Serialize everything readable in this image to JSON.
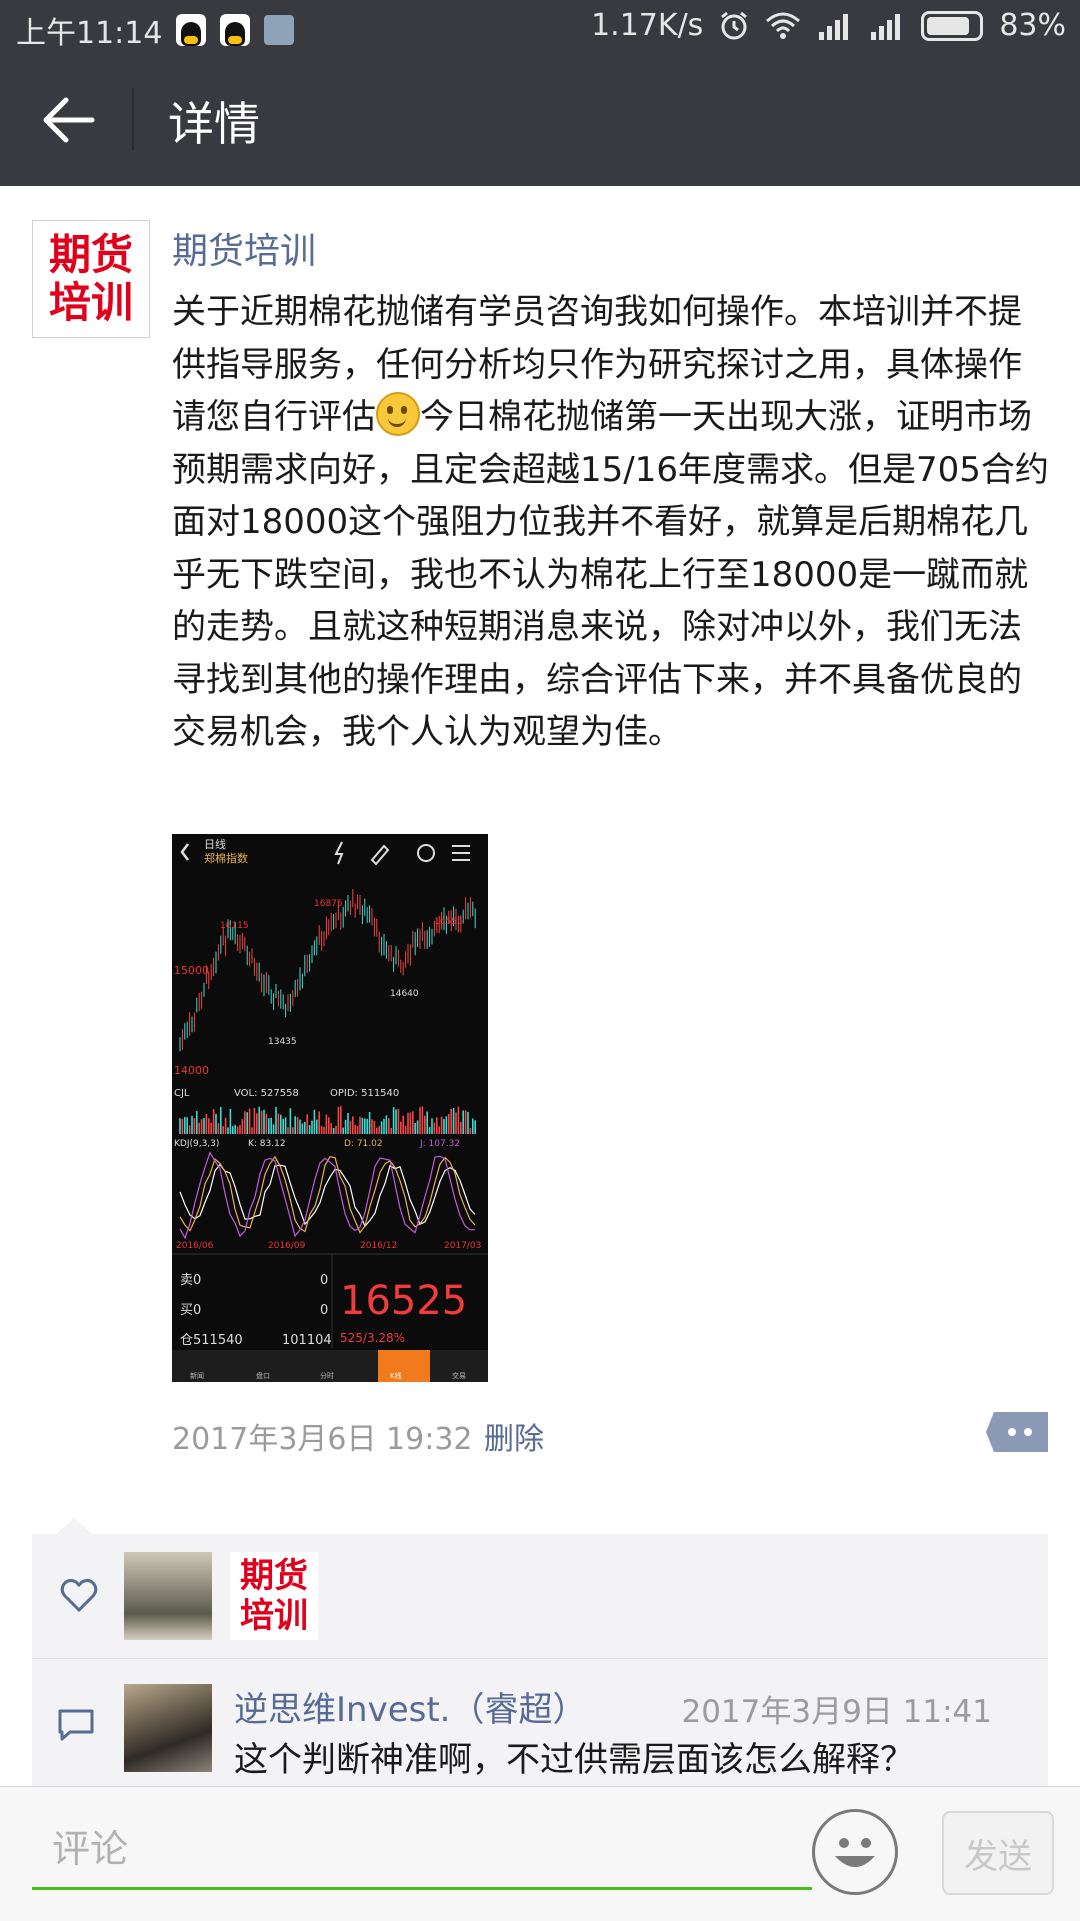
{
  "status_bar": {
    "time": "上午11:14",
    "network_speed": "1.17K/s",
    "battery": "83%"
  },
  "header": {
    "title": "详情"
  },
  "post": {
    "author": "期货培训",
    "avatar_text": [
      "期货",
      "培训"
    ],
    "content_before_emoji": "关于近期棉花抛储有学员咨询我如何操作。本培训并不提供指导服务，任何分析均只作为研究探讨之用，具体操作请您自行评估",
    "content_after_emoji": "今日棉花抛储第一天出现大涨，证明市场预期需求向好，且定会超越15/16年度需求。但是705合约面对18000这个强阻力位我并不看好，就算是后期棉花几乎无下跌空间，我也不认为棉花上行至18000是一蹴而就的走势。且就这种短期消息来说，除对冲以外，我们无法寻找到其他的操作理由，综合评估下来，并不具备优良的交易机会，我个人认为观望为佳。",
    "time": "2017年3月6日 19:32",
    "delete_label": "删除",
    "image": {
      "header_line1": "日线",
      "header_line2": "郑棉指数",
      "price_levels": [
        "16115",
        "16875",
        "16555",
        "15000",
        "14640",
        "13435",
        "14000"
      ],
      "vol_label": "CJL",
      "vol_text": "VOL: 527558",
      "opid_text": "OPID: 511540",
      "kdj_label": "KDJ(9,3,3)",
      "k_text": "K: 83.12",
      "d_text": "D: 71.02",
      "j_text": "J: 107.32",
      "dates": [
        "2016/06",
        "2016/09",
        "2016/12",
        "2017/03"
      ],
      "sell_label": "卖0",
      "sell_value": "0",
      "buy_label": "买0",
      "buy_value": "0",
      "position_label": "仓511540",
      "position_value": "101104",
      "big_price": "16525",
      "change": "525/3.28%",
      "tabs": [
        "新闻",
        "盘口",
        "分时",
        "K线",
        "交易"
      ]
    }
  },
  "likes": {
    "users": [
      "avatar-landscape",
      "期货培训"
    ],
    "like_avatar_text": [
      "期货",
      "培训"
    ]
  },
  "comments": [
    {
      "name": "逆思维Invest.（睿超）",
      "time": "2017年3月9日 11:41",
      "text": "这个判断神准啊，不过供需层面该怎么解释？"
    }
  ],
  "input_bar": {
    "placeholder": "评论",
    "send_label": "发送"
  },
  "colors": {
    "bar_bg": "#393a3f",
    "link": "#576b95",
    "accent_green": "#45c01a",
    "brand_red": "#e0001b"
  }
}
